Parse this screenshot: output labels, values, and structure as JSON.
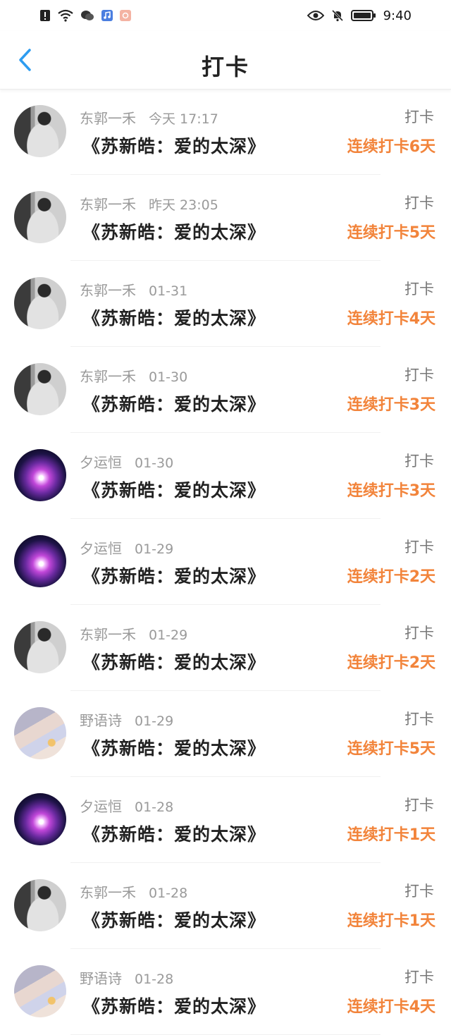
{
  "status": {
    "time": "9:40"
  },
  "header": {
    "title": "打卡"
  },
  "items": [
    {
      "name": "东郭一禾",
      "time": "今天 17:17",
      "song": "《苏新皓：爱的太深》",
      "action": "打卡",
      "streak": "连续打卡6天",
      "avatar": "av-boy"
    },
    {
      "name": "东郭一禾",
      "time": "昨天 23:05",
      "song": "《苏新皓：爱的太深》",
      "action": "打卡",
      "streak": "连续打卡5天",
      "avatar": "av-boy"
    },
    {
      "name": "东郭一禾",
      "time": "01-31",
      "song": "《苏新皓：爱的太深》",
      "action": "打卡",
      "streak": "连续打卡4天",
      "avatar": "av-boy"
    },
    {
      "name": "东郭一禾",
      "time": "01-30",
      "song": "《苏新皓：爱的太深》",
      "action": "打卡",
      "streak": "连续打卡3天",
      "avatar": "av-boy"
    },
    {
      "name": "夕运恒",
      "time": "01-30",
      "song": "《苏新皓：爱的太深》",
      "action": "打卡",
      "streak": "连续打卡3天",
      "avatar": "av-galaxy"
    },
    {
      "name": "夕运恒",
      "time": "01-29",
      "song": "《苏新皓：爱的太深》",
      "action": "打卡",
      "streak": "连续打卡2天",
      "avatar": "av-galaxy"
    },
    {
      "name": "东郭一禾",
      "time": "01-29",
      "song": "《苏新皓：爱的太深》",
      "action": "打卡",
      "streak": "连续打卡2天",
      "avatar": "av-boy"
    },
    {
      "name": "野语诗",
      "time": "01-29",
      "song": "《苏新皓：爱的太深》",
      "action": "打卡",
      "streak": "连续打卡5天",
      "avatar": "av-beach"
    },
    {
      "name": "夕运恒",
      "time": "01-28",
      "song": "《苏新皓：爱的太深》",
      "action": "打卡",
      "streak": "连续打卡1天",
      "avatar": "av-galaxy"
    },
    {
      "name": "东郭一禾",
      "time": "01-28",
      "song": "《苏新皓：爱的太深》",
      "action": "打卡",
      "streak": "连续打卡1天",
      "avatar": "av-boy"
    },
    {
      "name": "野语诗",
      "time": "01-28",
      "song": "《苏新皓：爱的太深》",
      "action": "打卡",
      "streak": "连续打卡4天",
      "avatar": "av-beach"
    }
  ],
  "icons": {
    "back": "chevron-left-icon",
    "alert": "alert-icon",
    "wifi": "wifi-icon",
    "wechat": "wechat-icon",
    "music": "music-app-icon",
    "app": "app-icon",
    "eye": "eye-icon",
    "mute": "bell-off-icon",
    "battery": "battery-icon"
  },
  "colors": {
    "accent": "#2d9cf0",
    "streak": "#f2843b"
  }
}
